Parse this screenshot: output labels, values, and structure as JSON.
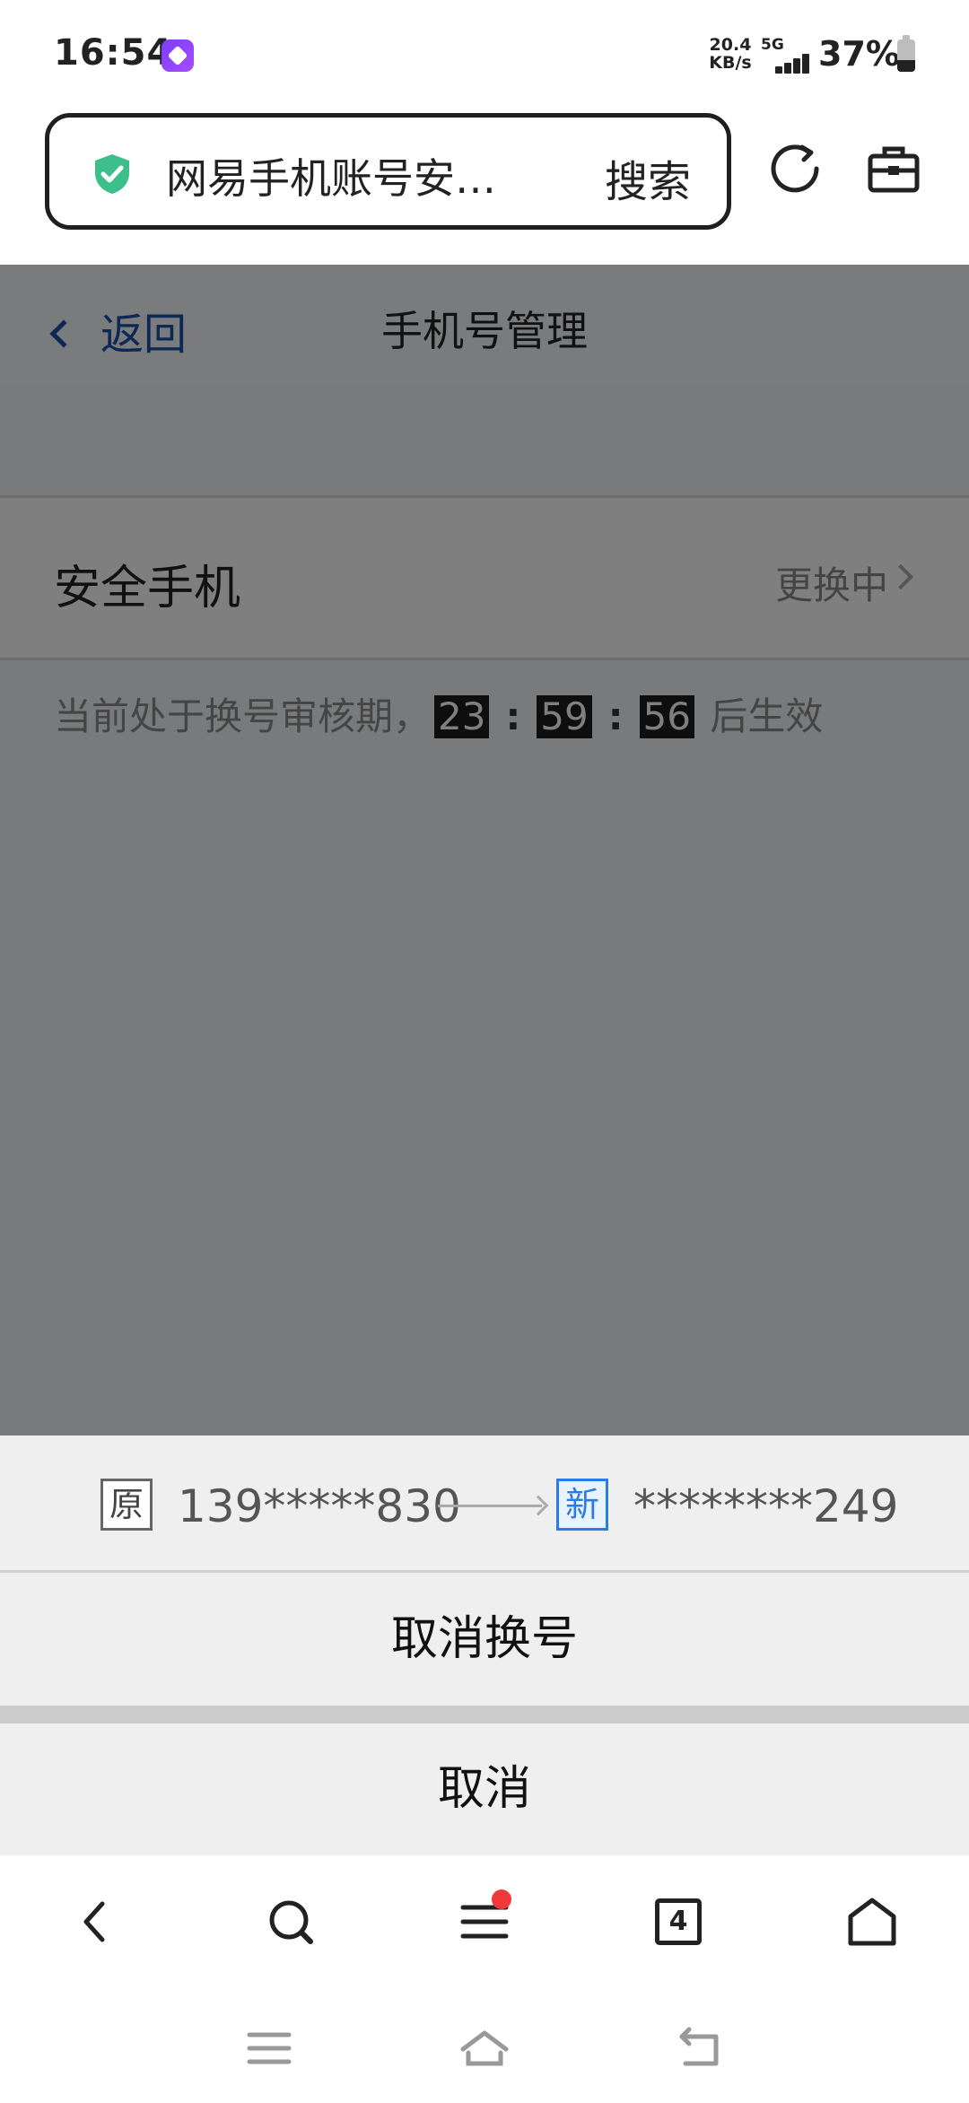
{
  "status_bar": {
    "time": "16:54",
    "net_speed_value": "20.4",
    "net_speed_unit": "KB/s",
    "network_type": "5G",
    "battery_percent": "37%"
  },
  "browser": {
    "address_text": "网易手机账号安…",
    "search_label": "搜索"
  },
  "page": {
    "back_label": "返回",
    "title": "手机号管理",
    "row_label": "安全手机",
    "row_status": "更换中",
    "notice_prefix": "当前处于换号审核期，",
    "countdown": {
      "hours": "23",
      "minutes": "59",
      "seconds": "56",
      "separator": ":"
    },
    "notice_suffix": "后生效"
  },
  "sheet": {
    "old_tag": "原",
    "old_number": "139*****830",
    "new_tag": "新",
    "new_number": "********249",
    "cancel_change_label": "取消换号",
    "cancel_label": "取消"
  },
  "toolbar": {
    "tabs_count": "4"
  },
  "colors": {
    "link_blue": "#1a50a8",
    "shield_green": "#3dbf8c",
    "new_tag_blue": "#2a7be4",
    "notification_red": "#f03a3a"
  }
}
